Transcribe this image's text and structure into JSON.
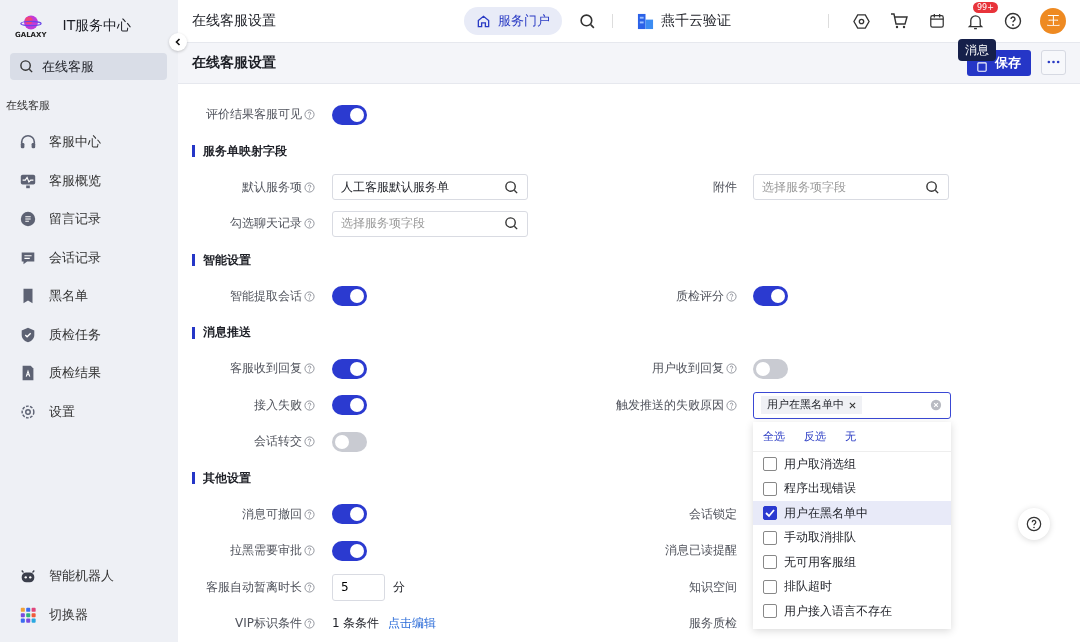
{
  "sidebar": {
    "logo_text": "GALAXY",
    "app_title": "IT服务中心",
    "search": {
      "value": "在线客服"
    },
    "group_label": "在线客服",
    "items": [
      {
        "label": "客服中心",
        "kind": "headset",
        "selected": false
      },
      {
        "label": "客服概览",
        "kind": "monitor",
        "selected": false
      },
      {
        "label": "留言记录",
        "kind": "note",
        "selected": false
      },
      {
        "label": "会话记录",
        "kind": "chat",
        "selected": false
      },
      {
        "label": "黑名单",
        "kind": "bookmark",
        "selected": false
      },
      {
        "label": "质检任务",
        "kind": "shield",
        "selected": false
      },
      {
        "label": "质检结果",
        "kind": "doc",
        "selected": false
      },
      {
        "label": "设置",
        "kind": "gear",
        "selected": false
      }
    ],
    "bottom_items": [
      {
        "label": "智能机器人",
        "kind": "robot"
      },
      {
        "label": "切换器",
        "kind": "apps"
      }
    ]
  },
  "header": {
    "page_title": "在线客服设置",
    "portal_button": {
      "label": "服务门户",
      "selected": true
    },
    "tenant": "燕千云验证",
    "notification_badge": "99+",
    "avatar": "王",
    "tooltip": "消息"
  },
  "subheader": {
    "title": "在线客服设置",
    "save_button": "保存"
  },
  "form": [
    {
      "kind": "row",
      "left": {
        "label": "评价结果客服可见",
        "control": {
          "kind": "toggle",
          "on": true
        }
      }
    },
    {
      "kind": "section",
      "title": "服务单映射字段"
    },
    {
      "kind": "row",
      "left": {
        "label": "默认服务项",
        "control": {
          "kind": "search",
          "value": "人工客服默认服务单"
        }
      },
      "right": {
        "label": "附件",
        "control": {
          "kind": "search",
          "placeholder": "选择服务项字段"
        }
      }
    },
    {
      "kind": "row",
      "left": {
        "label": "勾选聊天记录",
        "control": {
          "kind": "search",
          "placeholder": "选择服务项字段"
        }
      }
    },
    {
      "kind": "section",
      "title": "智能设置"
    },
    {
      "kind": "row",
      "left": {
        "label": "智能提取会话",
        "control": {
          "kind": "toggle",
          "on": true
        }
      },
      "right": {
        "label": "质检评分",
        "control": {
          "kind": "toggle",
          "on": true
        }
      }
    },
    {
      "kind": "section",
      "title": "消息推送"
    },
    {
      "kind": "row",
      "left": {
        "label": "客服收到回复",
        "control": {
          "kind": "toggle",
          "on": true
        }
      },
      "right": {
        "label": "用户收到回复",
        "control": {
          "kind": "toggle",
          "on": false
        }
      }
    },
    {
      "kind": "row",
      "left": {
        "label": "接入失败",
        "control": {
          "kind": "toggle",
          "on": true
        }
      },
      "right": {
        "label": "触发推送的失败原因",
        "control": {
          "kind": "multiselect",
          "tags": [
            "用户在黑名单中"
          ],
          "dropdown": {
            "actions": [
              "全选",
              "反选",
              "无"
            ],
            "options": [
              {
                "label": "用户取消选组",
                "checked": false
              },
              {
                "label": "程序出现错误",
                "checked": false
              },
              {
                "label": "用户在黑名单中",
                "checked": true
              },
              {
                "label": "手动取消排队",
                "checked": false
              },
              {
                "label": "无可用客服组",
                "checked": false
              },
              {
                "label": "排队超时",
                "checked": false
              },
              {
                "label": "用户接入语言不存在",
                "checked": false
              }
            ]
          }
        }
      }
    },
    {
      "kind": "row",
      "left": {
        "label": "会话转交",
        "control": {
          "kind": "toggle",
          "on": false
        }
      }
    },
    {
      "kind": "section",
      "title": "其他设置"
    },
    {
      "kind": "row",
      "left": {
        "label": "消息可撤回",
        "control": {
          "kind": "toggle",
          "on": true
        }
      },
      "right": {
        "label": "会话锁定"
      }
    },
    {
      "kind": "row",
      "left": {
        "label": "拉黑需要审批",
        "control": {
          "kind": "toggle",
          "on": true
        }
      },
      "right": {
        "label": "消息已读提醒"
      }
    },
    {
      "kind": "row",
      "left": {
        "label": "客服自动暂离时长",
        "control": {
          "kind": "number",
          "value": "5",
          "unit": "分"
        }
      },
      "right": {
        "label": "知识空间"
      }
    },
    {
      "kind": "row",
      "left": {
        "label": "VIP标识条件",
        "control": {
          "kind": "conditions",
          "text": "1 条条件",
          "link": "点击编辑"
        }
      },
      "right": {
        "label": "服务质检"
      }
    }
  ]
}
